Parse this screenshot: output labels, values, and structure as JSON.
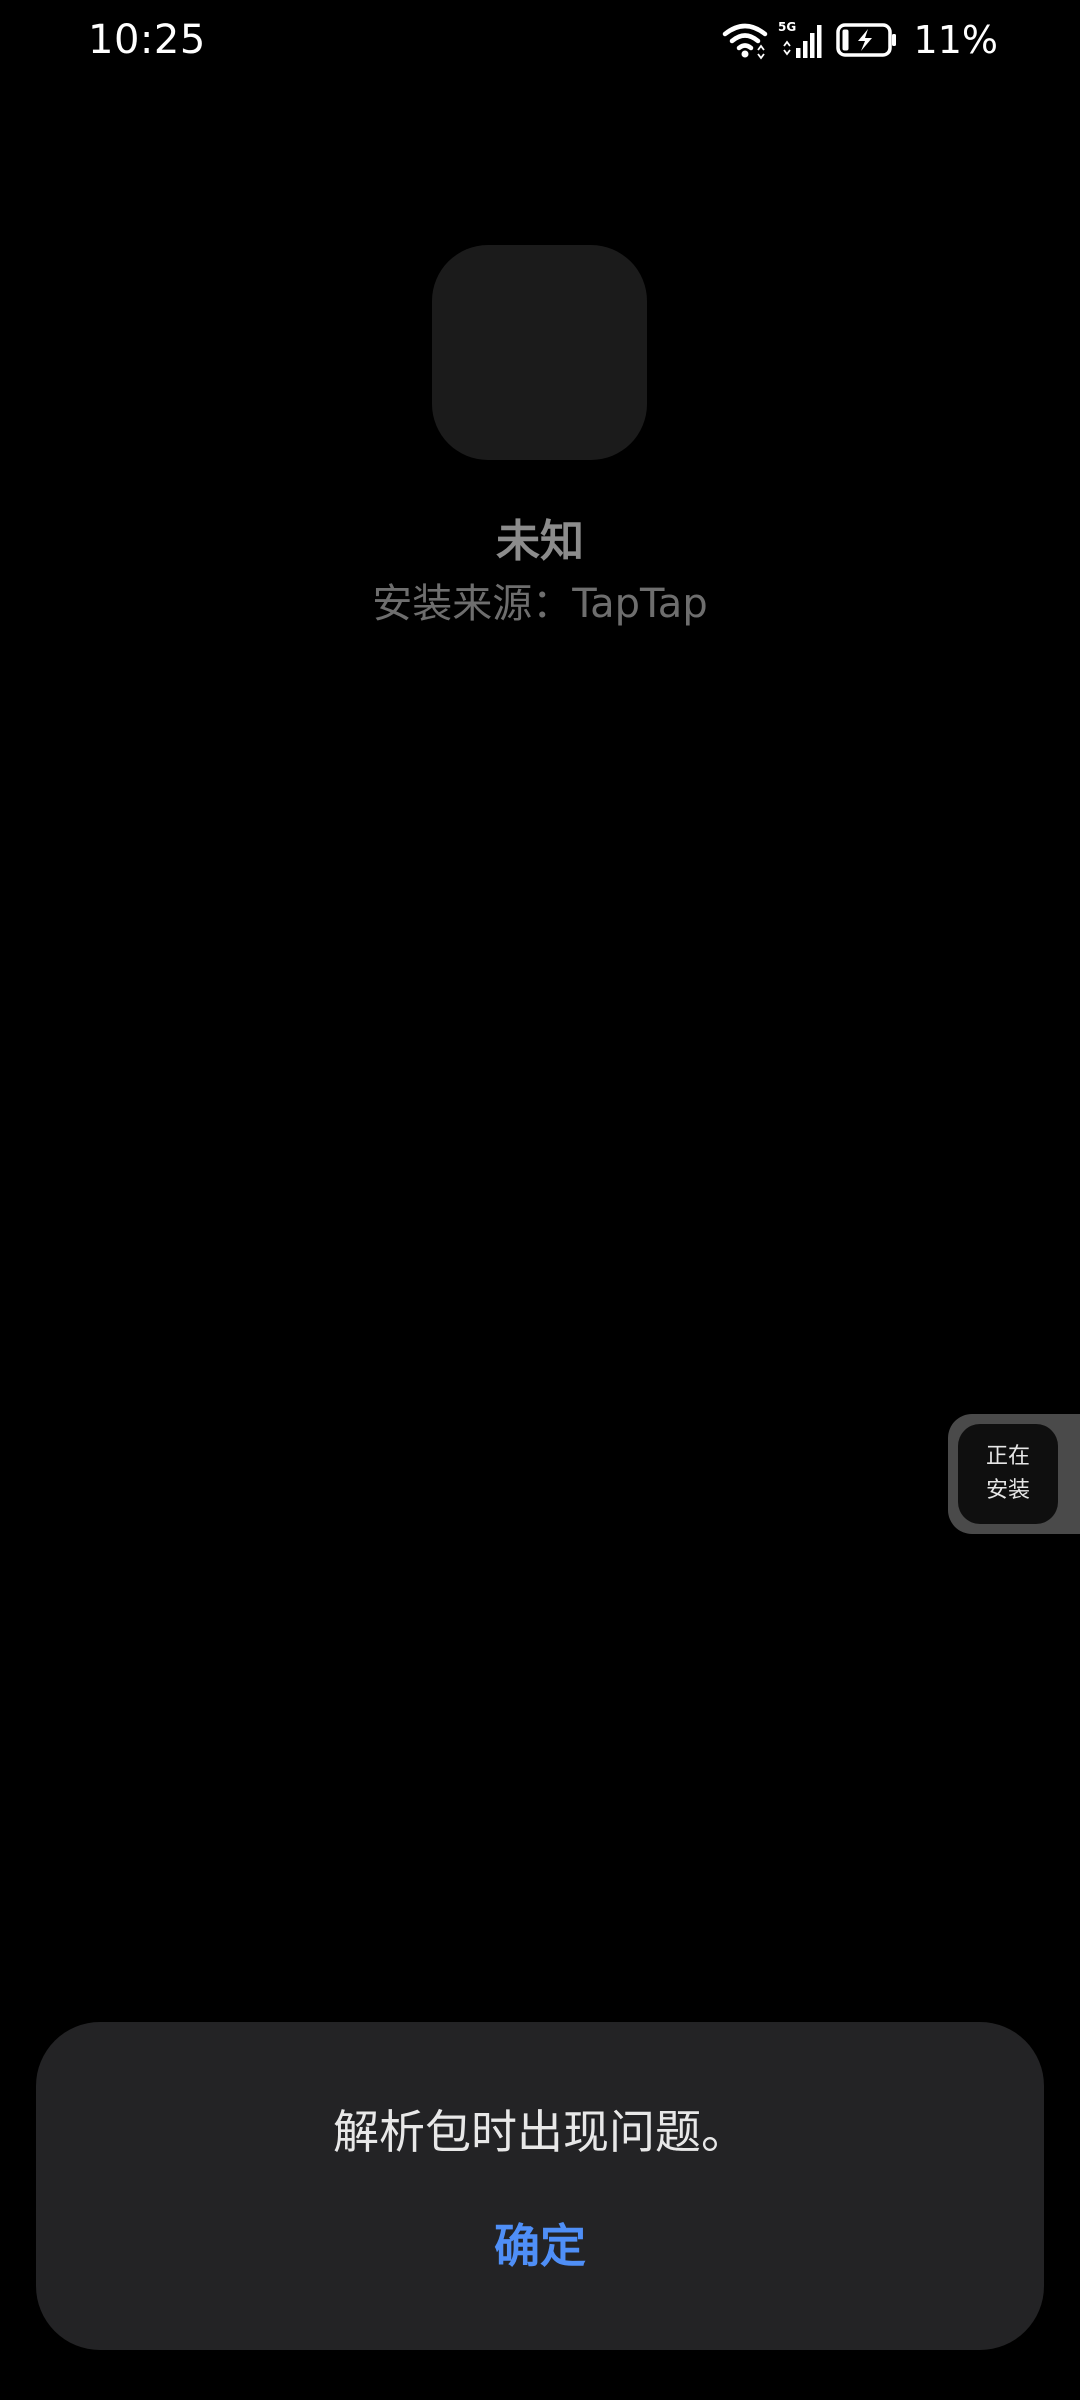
{
  "status_bar": {
    "time": "10:25",
    "network": "5G",
    "battery_percent": "11%",
    "icons": [
      "wifi-icon",
      "cellular-5g-icon",
      "battery-charging-icon"
    ]
  },
  "app": {
    "name": "未知",
    "install_source": "安装来源：TapTap"
  },
  "floating_widget": {
    "line1": "正在",
    "line2": "安装"
  },
  "dialog": {
    "message": "解析包时出现问题。",
    "confirm_label": "确定"
  },
  "colors": {
    "background": "#000000",
    "dialog_background": "#232325",
    "accent": "#4f8ff7",
    "app_icon_placeholder": "#1b1b1b"
  }
}
